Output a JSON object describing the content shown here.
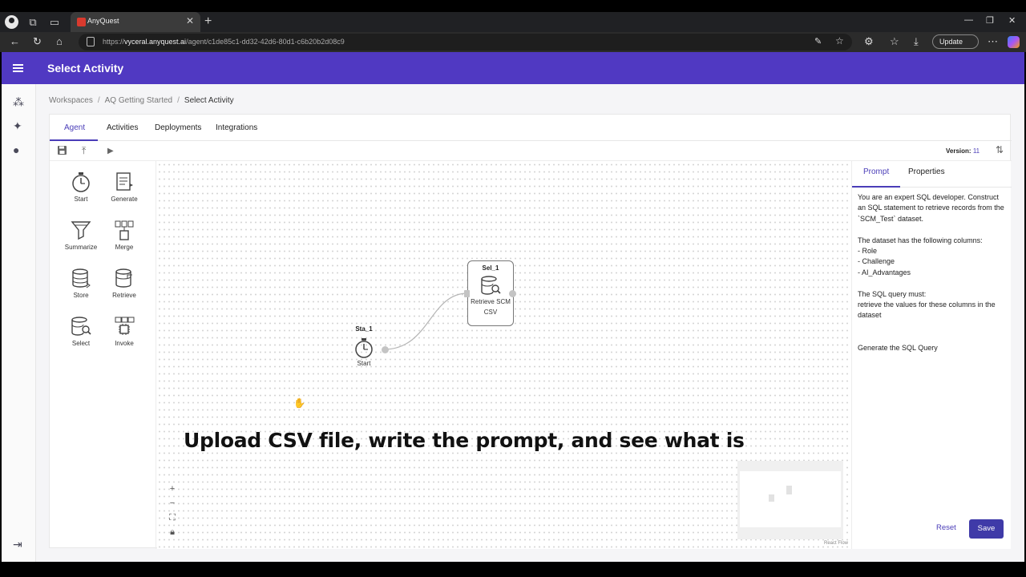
{
  "browser": {
    "tab_title": "AnyQuest",
    "url_prefix": "https://",
    "url_host": "vyceral.anyquest.ai",
    "url_path": "/agent/c1de85c1-dd32-42d6-80d1-c6b20b2d08c9",
    "update_label": "Update"
  },
  "app": {
    "title": "Select Activity"
  },
  "breadcrumb": {
    "items": [
      "Workspaces",
      "AQ Getting Started",
      "Select Activity"
    ]
  },
  "tabs": [
    "Agent",
    "Activities",
    "Deployments",
    "Integrations"
  ],
  "toolbar": {
    "version_label": "Version:",
    "version_value": "11"
  },
  "palette": {
    "items": [
      {
        "label": "Start",
        "icon": "stopwatch-icon"
      },
      {
        "label": "Generate",
        "icon": "document-icon"
      },
      {
        "label": "Summarize",
        "icon": "funnel-icon"
      },
      {
        "label": "Merge",
        "icon": "merge-icon"
      },
      {
        "label": "Store",
        "icon": "database-icon"
      },
      {
        "label": "Retrieve",
        "icon": "database-export-icon"
      },
      {
        "label": "Select",
        "icon": "database-search-icon"
      },
      {
        "label": "Invoke",
        "icon": "chip-icon"
      }
    ]
  },
  "canvas": {
    "nodes": [
      {
        "id": "Sta_1",
        "label": "Start"
      },
      {
        "id": "Sel_1",
        "label": "Retrieve SCM CSV"
      }
    ],
    "caption": "Upload CSV file, write the prompt, and see what is",
    "attribution": "React Flow"
  },
  "right_panel": {
    "tabs": [
      "Prompt",
      "Properties"
    ],
    "prompt_text": "You are an expert SQL developer. Construct an SQL statement to retrieve records from the `SCM_Test` dataset.\n\nThe dataset has the following columns:\n- Role\n- Challenge\n- AI_Advantages\n\nThe SQL query must:\nretrieve the values for these columns in the dataset\n\n\nGenerate the SQL Query",
    "reset_label": "Reset",
    "save_label": "Save"
  },
  "colors": {
    "appbar": "#5039c2",
    "accent": "#4a3db8",
    "save_button": "#3f3aa8"
  }
}
